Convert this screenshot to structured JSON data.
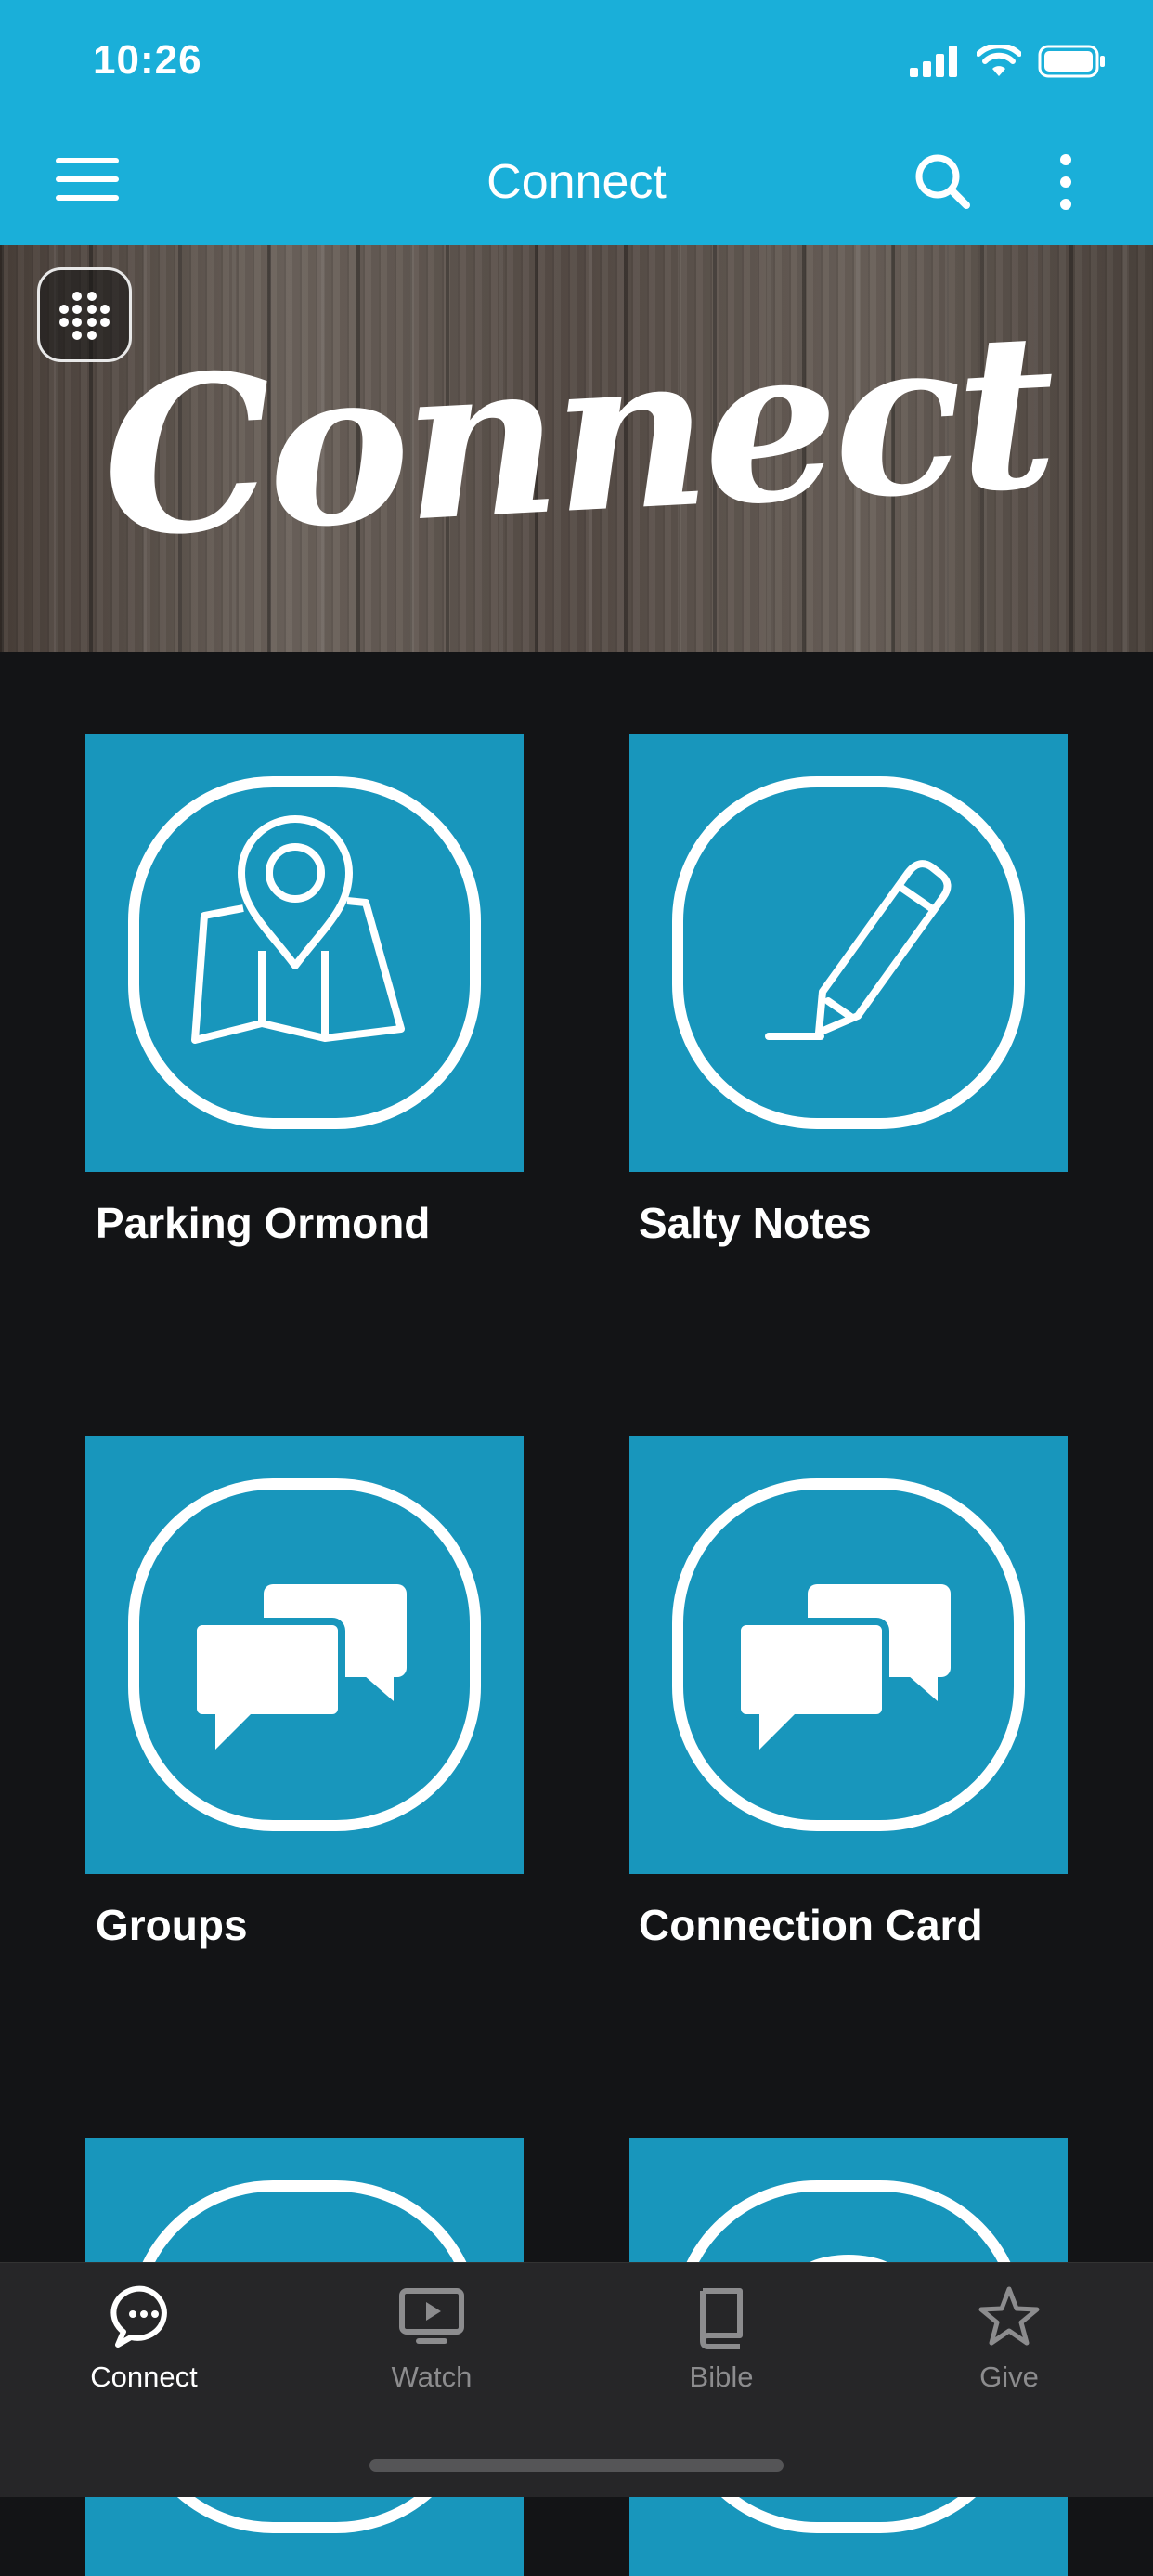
{
  "status_bar": {
    "time": "10:26"
  },
  "nav": {
    "title": "Connect"
  },
  "banner": {
    "text": "Connect"
  },
  "tiles": [
    {
      "label": "Parking Ormond",
      "icon": "map-pin-icon"
    },
    {
      "label": "Salty Notes",
      "icon": "pencil-icon"
    },
    {
      "label": "Groups",
      "icon": "chat-bubbles-icon"
    },
    {
      "label": "Connection Card",
      "icon": "chat-bubbles-icon"
    }
  ],
  "tabbar": {
    "items": [
      {
        "label": "Connect",
        "icon": "chat-icon",
        "active": true
      },
      {
        "label": "Watch",
        "icon": "tv-play-icon",
        "active": false
      },
      {
        "label": "Bible",
        "icon": "book-icon",
        "active": false
      },
      {
        "label": "Give",
        "icon": "star-icon",
        "active": false
      }
    ]
  },
  "colors": {
    "primary": "#1aafd9",
    "tile": "#1896bc",
    "background": "#131416",
    "tabbar": "#262628",
    "inactive": "#8c8c8e"
  }
}
